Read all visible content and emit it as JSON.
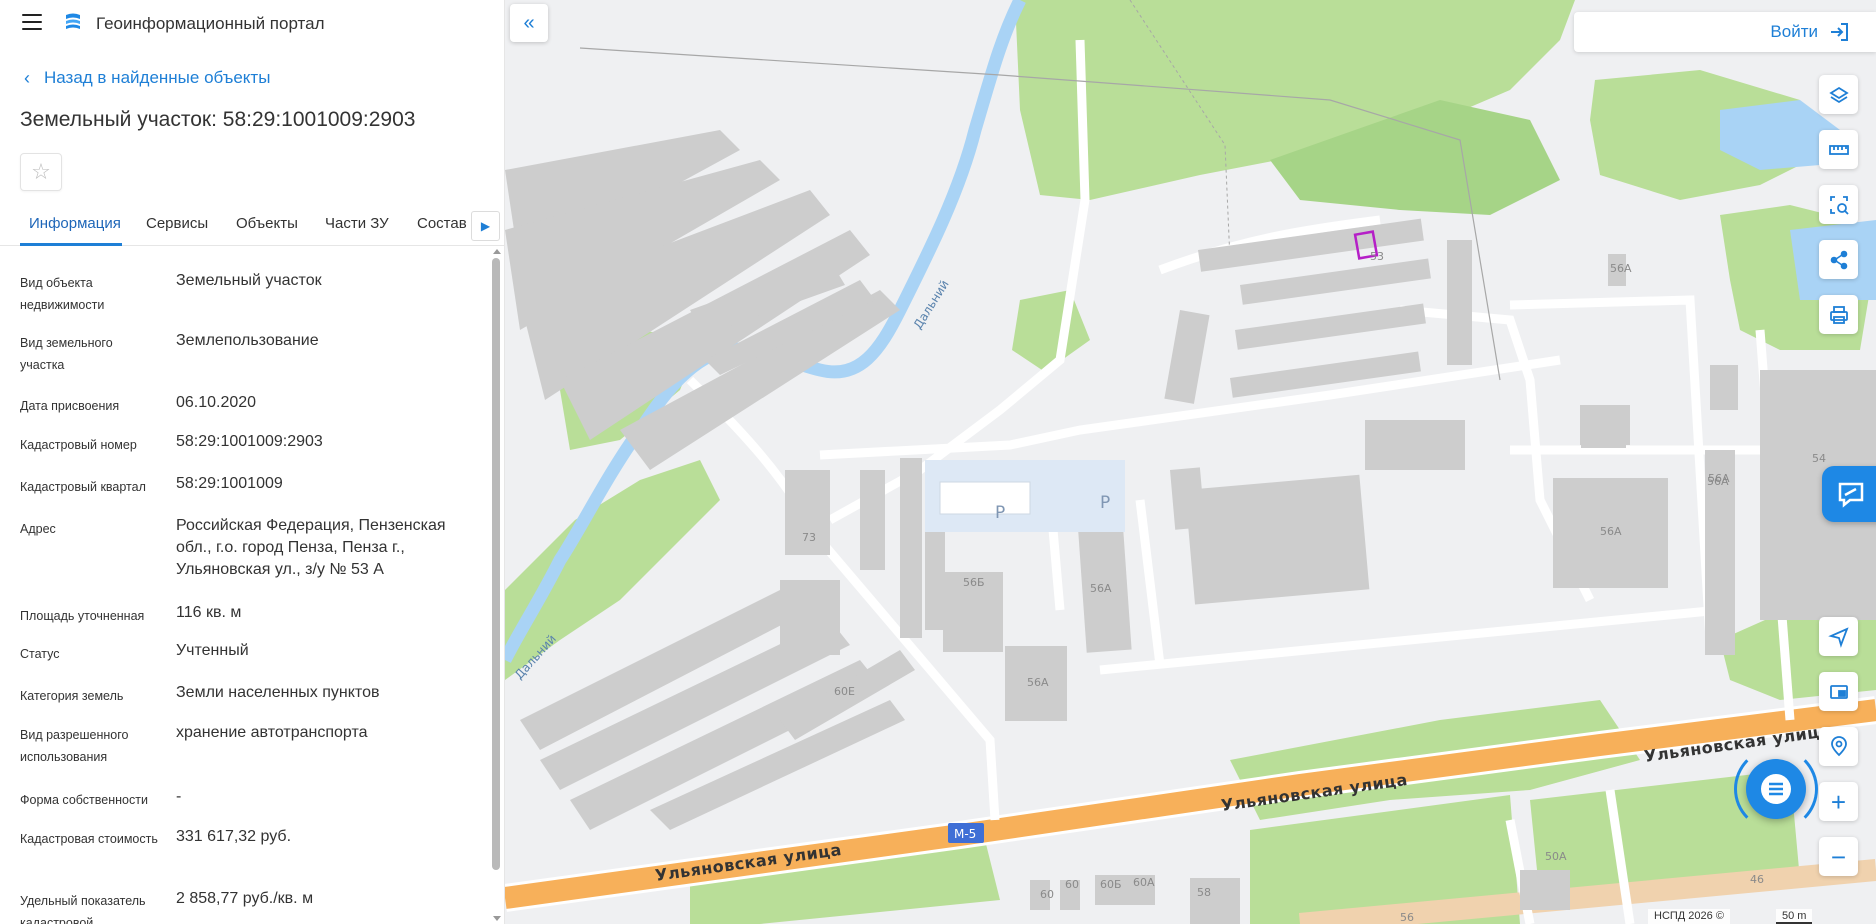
{
  "app": {
    "title": "Геоинформационный портал"
  },
  "nav": {
    "back_label": "Назад в найденные объекты"
  },
  "object": {
    "title": "Земельный участок: 58:29:1001009:2903"
  },
  "tabs": [
    {
      "label": "Информация",
      "active": true
    },
    {
      "label": "Сервисы",
      "active": false
    },
    {
      "label": "Объекты",
      "active": false
    },
    {
      "label": "Части ЗУ",
      "active": false
    },
    {
      "label": "Состав",
      "active": false
    }
  ],
  "properties": [
    {
      "label": "Вид объекта недвижимости",
      "value": "Земельный участок"
    },
    {
      "label": "Вид земельного участка",
      "value": "Землепользование"
    },
    {
      "label": "Дата присвоения",
      "value": "06.10.2020"
    },
    {
      "label": "Кадастровый номер",
      "value": "58:29:1001009:2903"
    },
    {
      "label": "Кадастровый квартал",
      "value": "58:29:1001009"
    },
    {
      "label": "Адрес",
      "value": "Российская Федерация, Пензенская обл., г.о. город Пенза, Пенза г., Ульяновская ул., з/у № 53 А"
    },
    {
      "label": "Площадь уточненная",
      "value": "116 кв. м"
    },
    {
      "label": "Статус",
      "value": "Учтенный"
    },
    {
      "label": "Категория земель",
      "value": "Земли населенных пунктов"
    },
    {
      "label": "Вид разрешенного использования",
      "value": "хранение автотранспорта"
    },
    {
      "label": "Форма собственности",
      "value": "-"
    },
    {
      "label": "Кадастровая стоимость",
      "value": "331 617,32 руб."
    },
    {
      "label": "Удельный показатель кадастровой",
      "value": "2 858,77 руб./кв. м"
    }
  ],
  "header_right": {
    "login_label": "Войти"
  },
  "map": {
    "streets": [
      "Ульяновская улица",
      "Ульяновская улица",
      "Ульяновская улица"
    ],
    "stream_labels": [
      "Дальний",
      "Дальний"
    ],
    "road_shield": "М-5",
    "parking_labels": [
      "P",
      "P"
    ],
    "building_labels": [
      "53",
      "56А",
      "56А",
      "56А",
      "56А",
      "56А",
      "56Б",
      "73",
      "60Е",
      "54",
      "56А",
      "50А",
      "60",
      "60",
      "60Б",
      "60А",
      "58",
      "56",
      "46"
    ],
    "attribution": "НСПД 2026 ©",
    "scale_label": "50 m"
  },
  "colors": {
    "accent": "#1e7fd6",
    "road_main": "#f7b05a",
    "park": "#b9de98",
    "water": "#a9d3f5",
    "building": "#cdcdcd",
    "selected_parcel": "#b51fc7"
  },
  "icons": {
    "layers": "layers-icon",
    "ruler": "ruler-icon",
    "select": "area-select-icon",
    "share": "share-icon",
    "print": "print-icon",
    "locate": "locate-arrow-icon",
    "minimap": "minimap-icon",
    "search_place": "search-place-icon",
    "zoom_in": "plus-icon",
    "zoom_out": "minus-icon"
  }
}
